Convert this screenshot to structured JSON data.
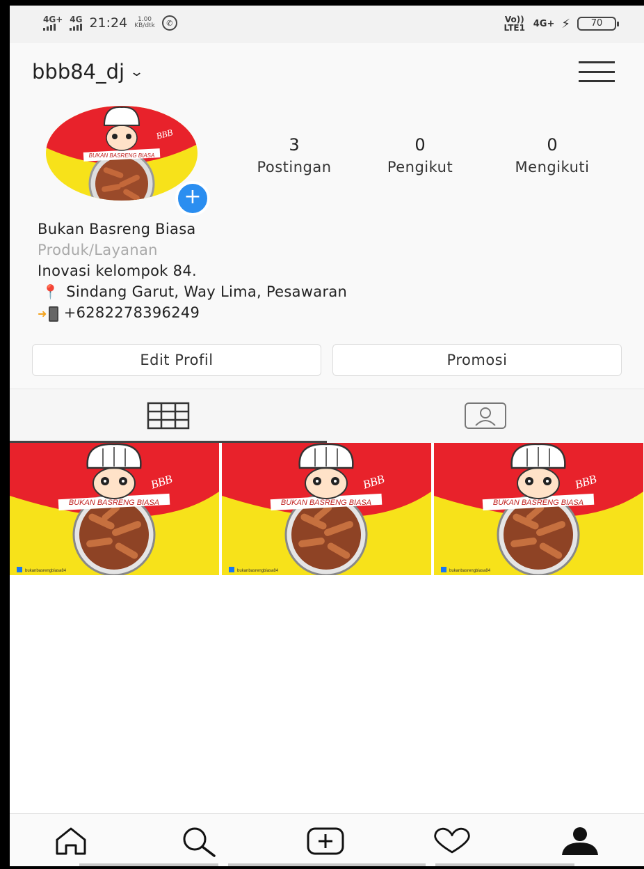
{
  "status_bar": {
    "sim1": "4G+",
    "sim2": "4G",
    "time": "21:24",
    "net_speed_value": "1.00",
    "net_speed_unit": "KB/dtk",
    "volte": "Vo)) LTE1",
    "network_right": "4G+",
    "battery": "70",
    "icons": [
      "signal-icon",
      "whatsapp-icon",
      "charging-icon",
      "battery-icon"
    ]
  },
  "header": {
    "username": "bbb84_dj",
    "icons": [
      "chevron-down-icon",
      "menu-icon"
    ]
  },
  "profile": {
    "stats": [
      {
        "value": "3",
        "label": "Postingan"
      },
      {
        "value": "0",
        "label": "Pengikut"
      },
      {
        "value": "0",
        "label": "Mengikuti"
      }
    ],
    "name": "Bukan Basreng Biasa",
    "category": "Produk/Layanan",
    "bio_line": "Inovasi kelompok 84.",
    "location": "Sindang Garut, Way Lima, Pesawaran",
    "phone": "+6282278396249",
    "avatar_text": "BUKAN BASRENG BIASA",
    "logo_text": "BBB"
  },
  "buttons": {
    "edit_profile": "Edit Profil",
    "promote": "Promosi"
  },
  "tabs": {
    "active": "grid",
    "items": [
      "grid-icon",
      "tagged-icon"
    ]
  },
  "posts": [
    {
      "banner": "BUKAN BASRENG BIASA",
      "logo": "BBB",
      "handle": "bukanbasrengbiasa84"
    },
    {
      "banner": "BUKAN BASRENG BIASA",
      "logo": "BBB",
      "handle": "bukanbasrengbiasa84"
    },
    {
      "banner": "BUKAN BASRENG BIASA",
      "logo": "BBB",
      "handle": "bukanbasrengbiasa84"
    }
  ],
  "bottom_nav": [
    "home-icon",
    "search-icon",
    "add-post-icon",
    "heart-icon",
    "profile-icon"
  ],
  "colors": {
    "brand_red": "#e8222b",
    "brand_yellow": "#f7e21a",
    "accent_blue": "#2b8ef0"
  }
}
